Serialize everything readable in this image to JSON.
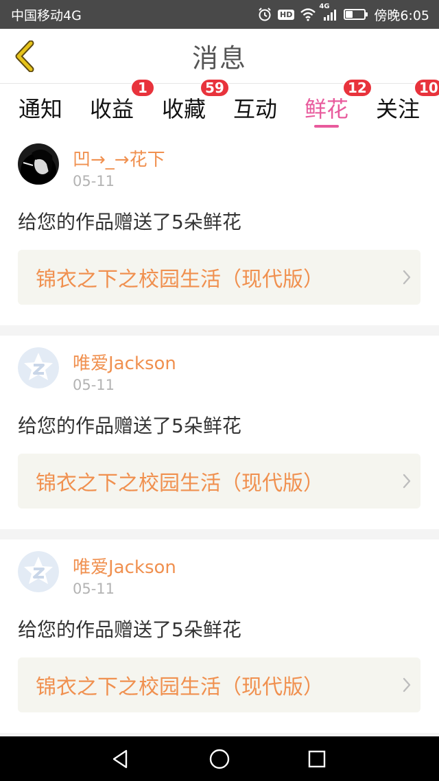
{
  "status_bar": {
    "carrier": "中国移动4G",
    "hd": "HD",
    "network": "4G",
    "time": "傍晚6:05",
    "battery_level": 0.35,
    "icons": [
      "alarm-icon",
      "hd-icon",
      "wifi-icon",
      "signal-icon",
      "battery-icon"
    ]
  },
  "header": {
    "title": "消息",
    "back_icon": "chevron-left-icon"
  },
  "tabs": [
    {
      "label": "通知",
      "badge": ""
    },
    {
      "label": "收益",
      "badge": "1"
    },
    {
      "label": "收藏",
      "badge": "59"
    },
    {
      "label": "互动",
      "badge": ""
    },
    {
      "label": "鲜花",
      "badge": "12"
    },
    {
      "label": "关注",
      "badge": "10"
    }
  ],
  "active_tab": "鲜花",
  "messages": [
    {
      "username": "凹→_→花下",
      "date": "05-11",
      "text": "给您的作品赠送了5朵鲜花",
      "work_title": "锦衣之下之校园生活（现代版）",
      "avatar": "photo-avatar"
    },
    {
      "username": "唯爱Jackson",
      "date": "05-11",
      "text": "给您的作品赠送了5朵鲜花",
      "work_title": "锦衣之下之校园生活（现代版）",
      "avatar": "default-star-avatar"
    },
    {
      "username": "唯爱Jackson",
      "date": "05-11",
      "text": "给您的作品赠送了5朵鲜花",
      "work_title": "锦衣之下之校园生活（现代版）",
      "avatar": "default-star-avatar"
    }
  ],
  "colors": {
    "accent_pink": "#e85a9c",
    "username_orange": "#f0904f",
    "badge_red": "#e8333c",
    "back_arrow_yellow": "#e6c31a",
    "status_bar_bg": "#494949"
  },
  "nav_bar": [
    "back-triangle-icon",
    "home-circle-icon",
    "recents-square-icon"
  ]
}
